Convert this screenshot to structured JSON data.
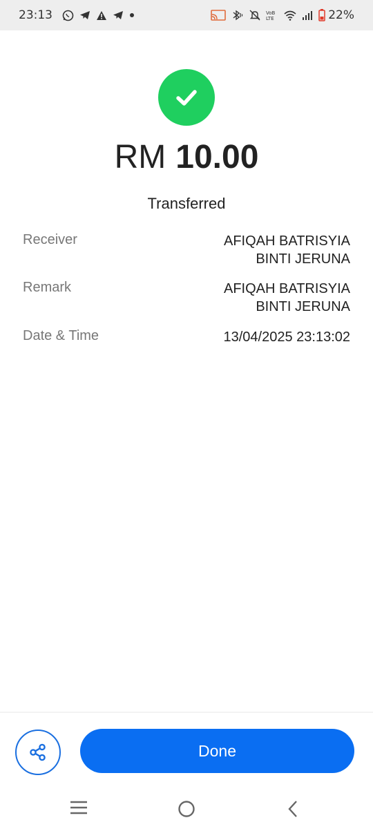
{
  "status_bar": {
    "time": "23:13",
    "battery_percent": "22%",
    "left_icons": [
      "whatsapp-icon",
      "telegram-icon",
      "warning-icon",
      "telegram-icon",
      "dot-icon"
    ],
    "right_icons": [
      "cast-icon",
      "bluetooth-icon",
      "mute-icon",
      "volte-icon",
      "wifi-icon",
      "signal-icon",
      "battery-icon"
    ]
  },
  "transaction": {
    "currency": "RM",
    "amount": "10.00",
    "status": "Transferred",
    "success_color": "#1fcf5f"
  },
  "details": {
    "receiver": {
      "label": "Receiver",
      "line1": "AFIQAH BATRISYIA",
      "line2": "BINTI JERUNA"
    },
    "remark": {
      "label": "Remark",
      "line1": "AFIQAH BATRISYIA",
      "line2": "BINTI JERUNA"
    },
    "date_time": {
      "label": "Date & Time",
      "value": "13/04/2025 23:13:02"
    }
  },
  "actions": {
    "share_icon": "share-icon",
    "done_label": "Done",
    "accent_color": "#0a6ef2"
  },
  "nav": {
    "icons": [
      "recent-apps-icon",
      "home-icon",
      "back-icon"
    ]
  }
}
